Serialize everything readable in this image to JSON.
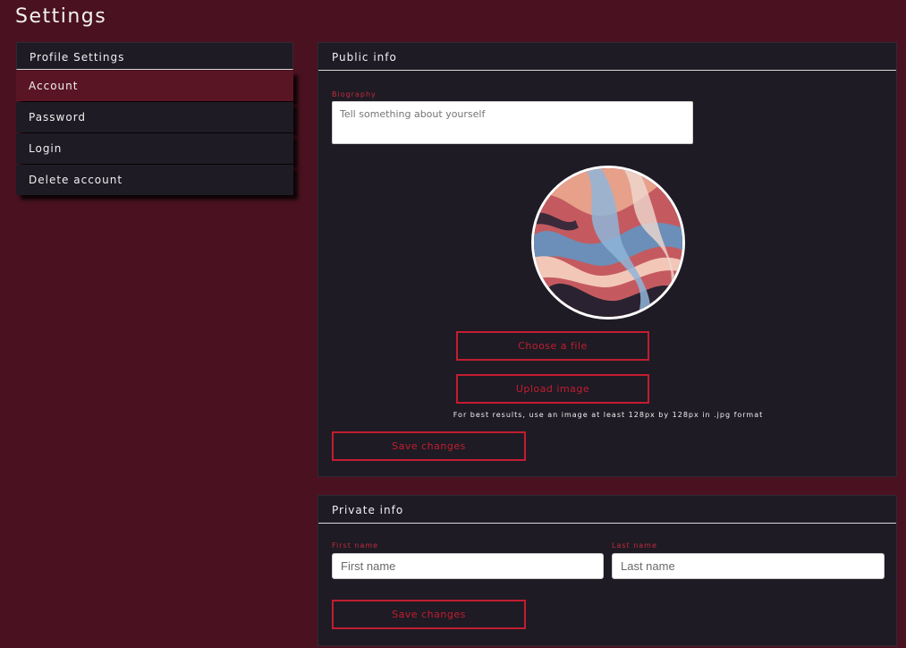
{
  "page": {
    "title": "Settings"
  },
  "sidebar": {
    "header": "Profile Settings",
    "items": [
      {
        "label": "Account",
        "active": true
      },
      {
        "label": "Password",
        "active": false
      },
      {
        "label": "Login",
        "active": false
      },
      {
        "label": "Delete account",
        "active": false
      }
    ]
  },
  "public_info": {
    "title": "Public info",
    "biography_label": "Biography",
    "biography_placeholder": "Tell something about yourself",
    "choose_file_label": "Choose a file",
    "upload_label": "Upload image",
    "hint": "For best results, use an image at least 128px by 128px in .jpg format",
    "save_label": "Save changes"
  },
  "private_info": {
    "title": "Private info",
    "first_name_label": "First name",
    "first_name_placeholder": "First name",
    "last_name_label": "Last name",
    "last_name_placeholder": "Last name",
    "save_label": "Save changes"
  },
  "colors": {
    "background": "#4a1220",
    "panel": "#1e1b24",
    "accent": "#c21d30",
    "active_item": "#5a1524"
  }
}
